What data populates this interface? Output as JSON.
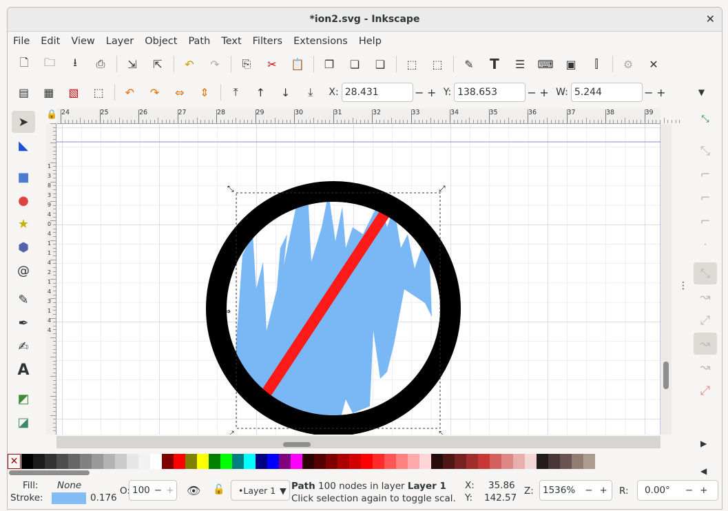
{
  "window": {
    "title": "*ion2.svg - Inkscape",
    "close": "✕"
  },
  "menu": [
    "File",
    "Edit",
    "View",
    "Layer",
    "Object",
    "Path",
    "Text",
    "Filters",
    "Extensions",
    "Help"
  ],
  "coords": {
    "x_label": "X:",
    "x_value": "28.431",
    "y_label": "Y:",
    "y_value": "138.653",
    "w_label": "W:",
    "w_value": "5.244"
  },
  "ruler_ticks": [
    "24",
    "25",
    "26",
    "27",
    "28",
    "29",
    "30",
    "31",
    "32",
    "33",
    "34",
    "35",
    "36",
    "37",
    "38",
    "39"
  ],
  "vruler_ticks": [
    "1",
    "3",
    "8",
    "3",
    "9",
    "4",
    "0",
    "4",
    "1",
    "1",
    "4",
    "2",
    "1",
    "4",
    "3",
    "1",
    "4",
    "4"
  ],
  "palette": [
    "#000000",
    "#1a1a1a",
    "#333333",
    "#4d4d4d",
    "#666666",
    "#808080",
    "#999999",
    "#b3b3b3",
    "#cccccc",
    "#e6e6e6",
    "#f2f2f2",
    "#ffffff",
    "#800000",
    "#ff0000",
    "#808000",
    "#ffff00",
    "#008000",
    "#00ff00",
    "#008080",
    "#00ffff",
    "#000080",
    "#0000ff",
    "#800080",
    "#ff00ff",
    "#2b0000",
    "#550000",
    "#800000",
    "#aa0000",
    "#d40000",
    "#ff0000",
    "#ff2a2a",
    "#ff5555",
    "#ff8080",
    "#ffaaaa",
    "#ffd5d5",
    "#280b0b",
    "#501616",
    "#782121",
    "#a02c2c",
    "#c83737",
    "#d35f5f",
    "#de8787",
    "#e9afaf",
    "#f4d7d7",
    "#241c1c",
    "#483737",
    "#6c5353",
    "#917c6f",
    "#ac9d93"
  ],
  "status": {
    "fill_label": "Fill:",
    "fill_value": "None",
    "stroke_label": "Stroke:",
    "stroke_width": "0.176",
    "stroke_color": "#83bcf5",
    "opacity_label": "O:",
    "opacity_value": "100",
    "layer": "•Layer 1",
    "msg_line1_a": "Path",
    "msg_line1_b": " 100 nodes in layer ",
    "msg_line1_c": "Layer 1",
    ".": ".",
    "msg_line2": "Click selection again to toggle scal...",
    "cx_label": "X:",
    "cx": "35.86",
    "cy_label": "Y:",
    "cy": "142.57",
    "zoom_label": "Z:",
    "zoom": "1536%",
    "rot_label": "R:",
    "rot": "0.00°"
  }
}
